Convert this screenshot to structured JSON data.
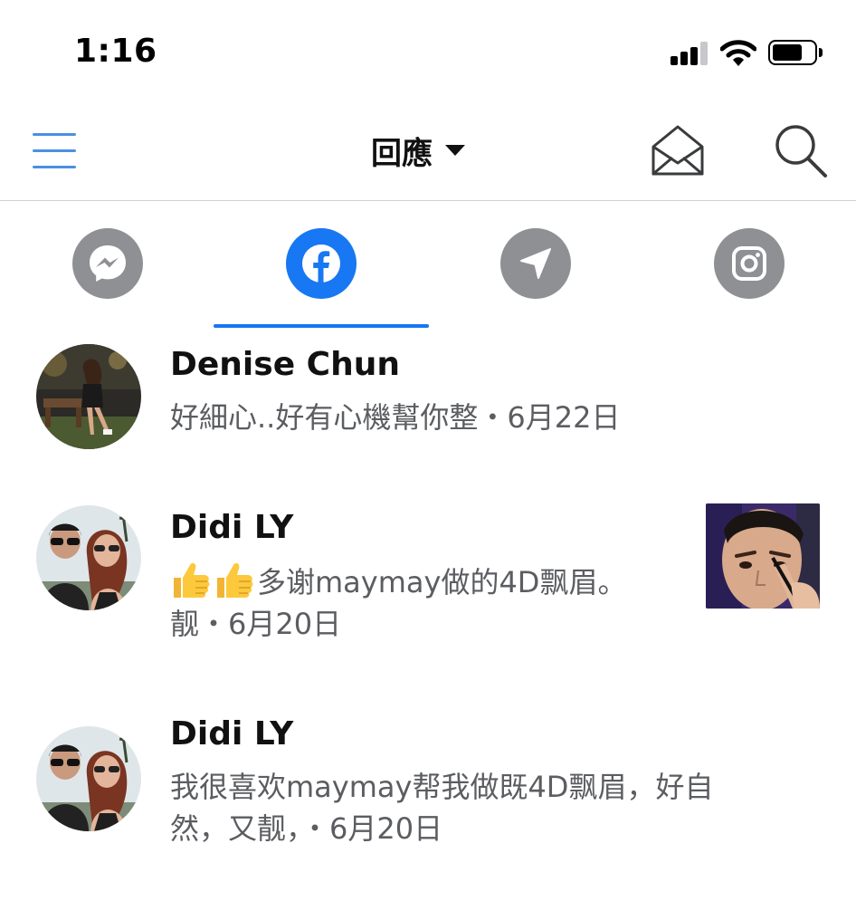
{
  "status_bar": {
    "time": "1:16"
  },
  "nav": {
    "title": "回應",
    "icons": [
      "menu-icon",
      "caret-down-icon",
      "mail-icon",
      "search-icon"
    ]
  },
  "tabs": [
    {
      "icon": "messenger-icon",
      "active": false
    },
    {
      "icon": "facebook-icon",
      "active": true
    },
    {
      "icon": "send-icon",
      "active": false
    },
    {
      "icon": "instagram-icon",
      "active": false
    }
  ],
  "colors": {
    "accent": "#1877f2",
    "menu_blue": "#4a90e2",
    "tab_gray": "#8e9094",
    "secondary_text": "#5b5d61"
  },
  "comments": [
    {
      "name": "Denise Chun",
      "text": "好細心..好有心機幫你整",
      "date": "・6月22日"
    },
    {
      "name": "Didi LY",
      "emoji": "thumbs-up-icon thumbs-up-icon",
      "text_line1": "多谢maymay做的4D飘眉。",
      "text_line2": "靓",
      "date": "・6月20日"
    },
    {
      "name": "Didi LY",
      "text_line1": "我很喜欢maymay帮我做既4D飘眉，好自",
      "text_line2": "然，又靓，",
      "date": "・6月20日"
    }
  ]
}
